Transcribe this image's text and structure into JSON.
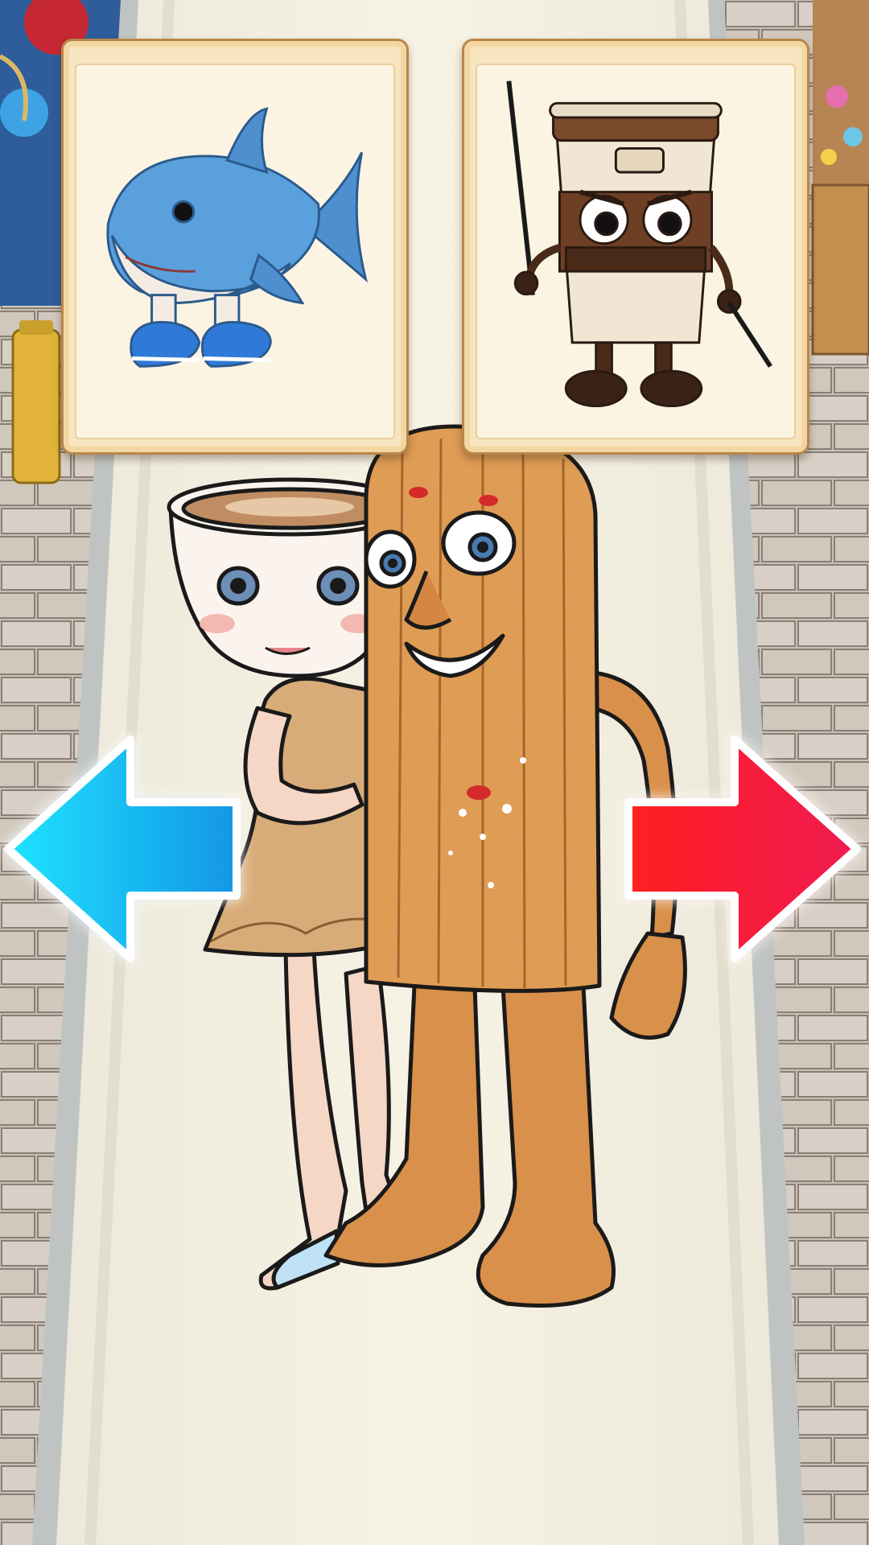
{
  "game": {
    "choices": [
      {
        "id": "left",
        "item": "shark-plush-with-sneakers",
        "arrow_color": "#18c8f0"
      },
      {
        "id": "right",
        "item": "coffee-cup-character-with-sword",
        "arrow_color": "#f0203a"
      }
    ],
    "character": {
      "left_figure": "coffee-cup-head-ballerina",
      "right_figure": "wooden-log-man"
    },
    "colors": {
      "road": "#f4efdd",
      "curb": "#cfd3cf",
      "card_frame": "#f3d7a2",
      "arrow_left": "#18c8f0",
      "arrow_right": "#f0203a"
    }
  }
}
